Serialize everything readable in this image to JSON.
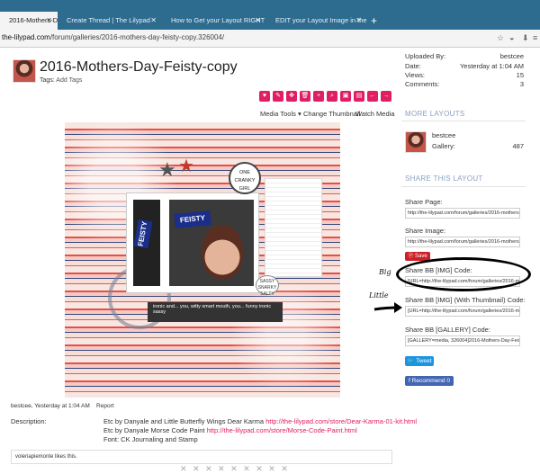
{
  "browser": {
    "tabs": [
      {
        "label": "2016-Mothers-Day-Feisty-copy | The",
        "active": true
      },
      {
        "label": "Create Thread | The Lilypad",
        "active": false
      },
      {
        "label": "How to Get your Layout RIGHT in the",
        "active": false
      },
      {
        "label": "EDIT your Layout Image in the Galle",
        "active": false
      }
    ],
    "new_tab": "+",
    "url_host": "the-lilypad.com",
    "url_path": "/forum/galleries/2016-mothers-day-feisty-copy.326004/"
  },
  "gallery": {
    "title": "2016-Mothers-Day-Feisty-copy",
    "tags_label": "Tags:",
    "tags_link": "Add Tags",
    "media_tools": "Media Tools ▾",
    "change_thumbnail": "Change Thumbnail",
    "watch_media": "Watch Media",
    "image_text": {
      "candy": "FEISTY",
      "badge": "ONE CRANKY GIRL",
      "sticker": "SASSY SNARKY SALTY",
      "caption": "ironic and... you, witty smart mouth, you... funny ironic sassy"
    },
    "byline": "bestcee, Yesterday at 1:04 AM",
    "report": "Report",
    "description_label": "Description:",
    "description_lines": [
      {
        "text": "Etc by Danyale and Little Butterfly Wings Dear Karma ",
        "link": "http://the-lilypad.com/store/Dear-Karma-01-kit.html"
      },
      {
        "text": "Etc by Danyale Morse Code Paint ",
        "link": "http://the-lilypad.com/store/Morse-Code-Paint.html"
      },
      {
        "text": "Font: CK Journaling and Stamp",
        "link": ""
      }
    ],
    "likes": "voleriapiemonte likes this."
  },
  "sidebar": {
    "info": [
      {
        "label": "Uploaded By:",
        "value": "bestcee"
      },
      {
        "label": "Date:",
        "value": "Yesterday at 1:04 AM"
      },
      {
        "label": "Views:",
        "value": "15"
      },
      {
        "label": "Comments:",
        "value": "3"
      }
    ],
    "more_layouts_heading": "MORE LAYOUTS",
    "user": {
      "name": "bestcee",
      "gallery_label": "Gallery:",
      "gallery_count": "487"
    },
    "share_heading": "SHARE THIS LAYOUT",
    "share_page_label": "Share Page:",
    "share_page_value": "http://the-lilypad.com/forum/galleries/2016-mothers-d",
    "share_image_label": "Share Image:",
    "share_image_value": "http://the-lilypad.com/forum/galleries/2016-mothers-d",
    "save_label": "Save",
    "bb_img_label": "Share BB [IMG] Code:",
    "bb_img_value": "[URL=http://the-lilypad.com/forum/galleries/2016-mot",
    "bb_thumb_label": "Share BB [IMG] (With Thumbnail) Code:",
    "bb_thumb_value": "[URL=http://the-lilypad.com/forum/galleries/2016-mot",
    "bb_gallery_label": "Share BB [GALLERY] Code:",
    "bb_gallery_value": "[GALLERY=media, 326004]2016-Mothers-Day-Feisty-cop",
    "tweet_label": "Tweet",
    "fb_label": "Recommend 0"
  },
  "annotations": {
    "big": "Big",
    "little": "Little"
  }
}
